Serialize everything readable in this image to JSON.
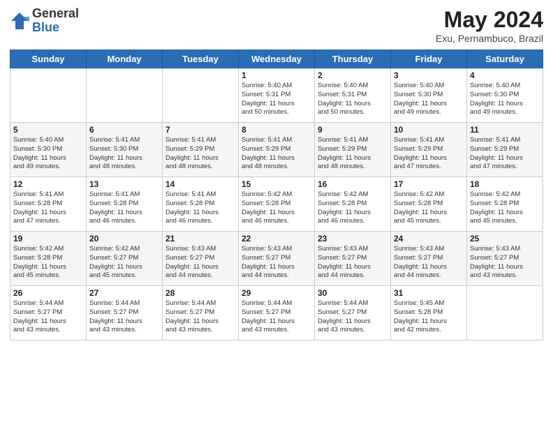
{
  "header": {
    "logo_general": "General",
    "logo_blue": "Blue",
    "title": "May 2024",
    "subtitle": "Exu, Pernambuco, Brazil"
  },
  "columns": [
    "Sunday",
    "Monday",
    "Tuesday",
    "Wednesday",
    "Thursday",
    "Friday",
    "Saturday"
  ],
  "weeks": [
    [
      {
        "day": "",
        "info": ""
      },
      {
        "day": "",
        "info": ""
      },
      {
        "day": "",
        "info": ""
      },
      {
        "day": "1",
        "info": "Sunrise: 5:40 AM\nSunset: 5:31 PM\nDaylight: 11 hours\nand 50 minutes."
      },
      {
        "day": "2",
        "info": "Sunrise: 5:40 AM\nSunset: 5:31 PM\nDaylight: 11 hours\nand 50 minutes."
      },
      {
        "day": "3",
        "info": "Sunrise: 5:40 AM\nSunset: 5:30 PM\nDaylight: 11 hours\nand 49 minutes."
      },
      {
        "day": "4",
        "info": "Sunrise: 5:40 AM\nSunset: 5:30 PM\nDaylight: 11 hours\nand 49 minutes."
      }
    ],
    [
      {
        "day": "5",
        "info": "Sunrise: 5:40 AM\nSunset: 5:30 PM\nDaylight: 11 hours\nand 49 minutes."
      },
      {
        "day": "6",
        "info": "Sunrise: 5:41 AM\nSunset: 5:30 PM\nDaylight: 11 hours\nand 48 minutes."
      },
      {
        "day": "7",
        "info": "Sunrise: 5:41 AM\nSunset: 5:29 PM\nDaylight: 11 hours\nand 48 minutes."
      },
      {
        "day": "8",
        "info": "Sunrise: 5:41 AM\nSunset: 5:29 PM\nDaylight: 11 hours\nand 48 minutes."
      },
      {
        "day": "9",
        "info": "Sunrise: 5:41 AM\nSunset: 5:29 PM\nDaylight: 11 hours\nand 48 minutes."
      },
      {
        "day": "10",
        "info": "Sunrise: 5:41 AM\nSunset: 5:29 PM\nDaylight: 11 hours\nand 47 minutes."
      },
      {
        "day": "11",
        "info": "Sunrise: 5:41 AM\nSunset: 5:29 PM\nDaylight: 11 hours\nand 47 minutes."
      }
    ],
    [
      {
        "day": "12",
        "info": "Sunrise: 5:41 AM\nSunset: 5:28 PM\nDaylight: 11 hours\nand 47 minutes."
      },
      {
        "day": "13",
        "info": "Sunrise: 5:41 AM\nSunset: 5:28 PM\nDaylight: 11 hours\nand 46 minutes."
      },
      {
        "day": "14",
        "info": "Sunrise: 5:41 AM\nSunset: 5:28 PM\nDaylight: 11 hours\nand 46 minutes."
      },
      {
        "day": "15",
        "info": "Sunrise: 5:42 AM\nSunset: 5:28 PM\nDaylight: 11 hours\nand 46 minutes."
      },
      {
        "day": "16",
        "info": "Sunrise: 5:42 AM\nSunset: 5:28 PM\nDaylight: 11 hours\nand 46 minutes."
      },
      {
        "day": "17",
        "info": "Sunrise: 5:42 AM\nSunset: 5:28 PM\nDaylight: 11 hours\nand 45 minutes."
      },
      {
        "day": "18",
        "info": "Sunrise: 5:42 AM\nSunset: 5:28 PM\nDaylight: 11 hours\nand 45 minutes."
      }
    ],
    [
      {
        "day": "19",
        "info": "Sunrise: 5:42 AM\nSunset: 5:28 PM\nDaylight: 11 hours\nand 45 minutes."
      },
      {
        "day": "20",
        "info": "Sunrise: 5:42 AM\nSunset: 5:27 PM\nDaylight: 11 hours\nand 45 minutes."
      },
      {
        "day": "21",
        "info": "Sunrise: 5:43 AM\nSunset: 5:27 PM\nDaylight: 11 hours\nand 44 minutes."
      },
      {
        "day": "22",
        "info": "Sunrise: 5:43 AM\nSunset: 5:27 PM\nDaylight: 11 hours\nand 44 minutes."
      },
      {
        "day": "23",
        "info": "Sunrise: 5:43 AM\nSunset: 5:27 PM\nDaylight: 11 hours\nand 44 minutes."
      },
      {
        "day": "24",
        "info": "Sunrise: 5:43 AM\nSunset: 5:27 PM\nDaylight: 11 hours\nand 44 minutes."
      },
      {
        "day": "25",
        "info": "Sunrise: 5:43 AM\nSunset: 5:27 PM\nDaylight: 11 hours\nand 43 minutes."
      }
    ],
    [
      {
        "day": "26",
        "info": "Sunrise: 5:44 AM\nSunset: 5:27 PM\nDaylight: 11 hours\nand 43 minutes."
      },
      {
        "day": "27",
        "info": "Sunrise: 5:44 AM\nSunset: 5:27 PM\nDaylight: 11 hours\nand 43 minutes."
      },
      {
        "day": "28",
        "info": "Sunrise: 5:44 AM\nSunset: 5:27 PM\nDaylight: 11 hours\nand 43 minutes."
      },
      {
        "day": "29",
        "info": "Sunrise: 5:44 AM\nSunset: 5:27 PM\nDaylight: 11 hours\nand 43 minutes."
      },
      {
        "day": "30",
        "info": "Sunrise: 5:44 AM\nSunset: 5:27 PM\nDaylight: 11 hours\nand 43 minutes."
      },
      {
        "day": "31",
        "info": "Sunrise: 5:45 AM\nSunset: 5:28 PM\nDaylight: 11 hours\nand 42 minutes."
      },
      {
        "day": "",
        "info": ""
      }
    ]
  ]
}
